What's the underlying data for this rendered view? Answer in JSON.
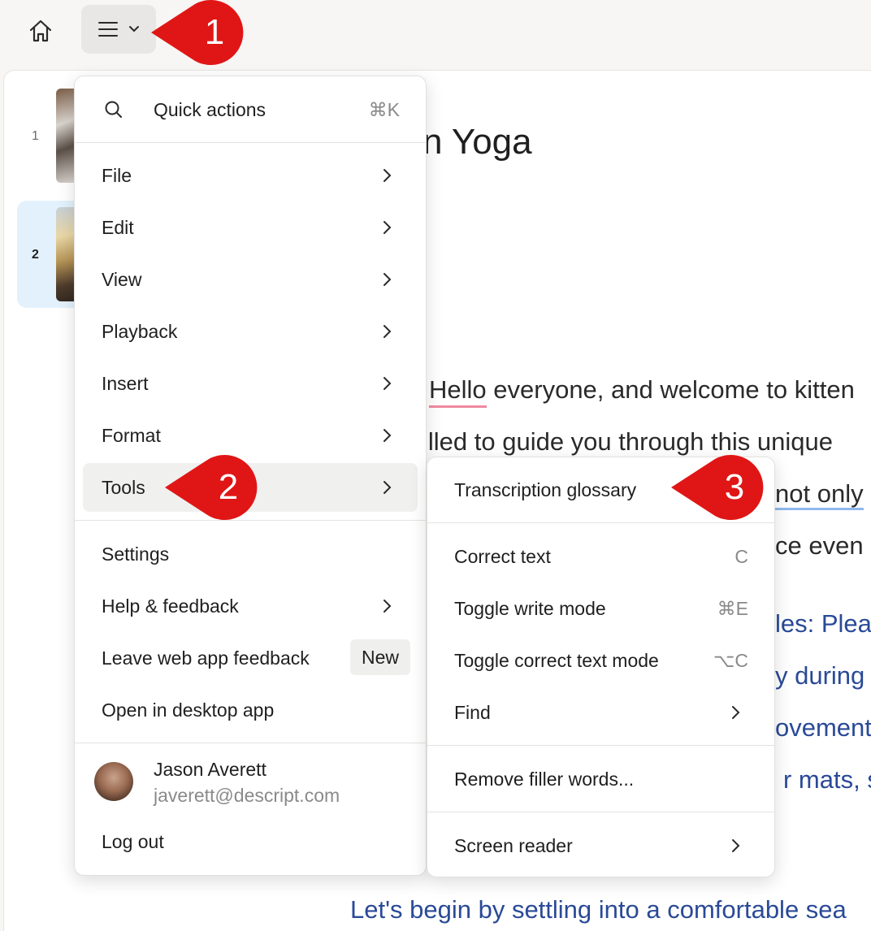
{
  "topbar": {
    "home_icon": "home-icon",
    "menu_icon": "hamburger-icon",
    "menu_chevron_icon": "chevron-down-icon"
  },
  "scenes": [
    {
      "number": "1"
    },
    {
      "number": "2"
    }
  ],
  "document": {
    "title": "n Yoga",
    "lines": [
      {
        "pre": "",
        "hl": "Hello",
        "post": " everyone, and welcome to kitten"
      },
      {
        "text": "illed to guide you through this unique"
      },
      {
        "text": "not only"
      },
      {
        "text": "ce even m"
      },
      {
        "text": "les: Plea"
      },
      {
        "text": "y during"
      },
      {
        "text": "ovement"
      },
      {
        "text": "r mats, so"
      },
      {
        "text": "Let's begin by settling into a comfortable sea"
      }
    ]
  },
  "main_menu": {
    "quick_actions": {
      "label": "Quick actions",
      "shortcut": "⌘K",
      "icon": "search-icon"
    },
    "items": [
      {
        "label": "File"
      },
      {
        "label": "Edit"
      },
      {
        "label": "View"
      },
      {
        "label": "Playback"
      },
      {
        "label": "Insert"
      },
      {
        "label": "Format"
      },
      {
        "label": "Tools"
      }
    ],
    "settings": "Settings",
    "help": "Help & feedback",
    "feedback": {
      "label": "Leave web app feedback",
      "badge": "New"
    },
    "desktop": "Open in desktop app",
    "user": {
      "name": "Jason Averett",
      "email": "javerett@descript.com"
    },
    "logout": "Log out"
  },
  "tools_menu": {
    "glossary": "Transcription glossary",
    "correct_text": {
      "label": "Correct text",
      "shortcut": "C"
    },
    "write_mode": {
      "label": "Toggle write mode",
      "shortcut": "⌘E"
    },
    "correct_mode": {
      "label": "Toggle correct text mode",
      "shortcut": "⌥C"
    },
    "find": "Find",
    "filler": "Remove filler words...",
    "screen_reader": "Screen reader"
  },
  "callouts": [
    "1",
    "2",
    "3"
  ],
  "colors": {
    "callout": "#e01616",
    "selected_scene": "#e3f1fd",
    "link_text": "#2a4a97"
  }
}
